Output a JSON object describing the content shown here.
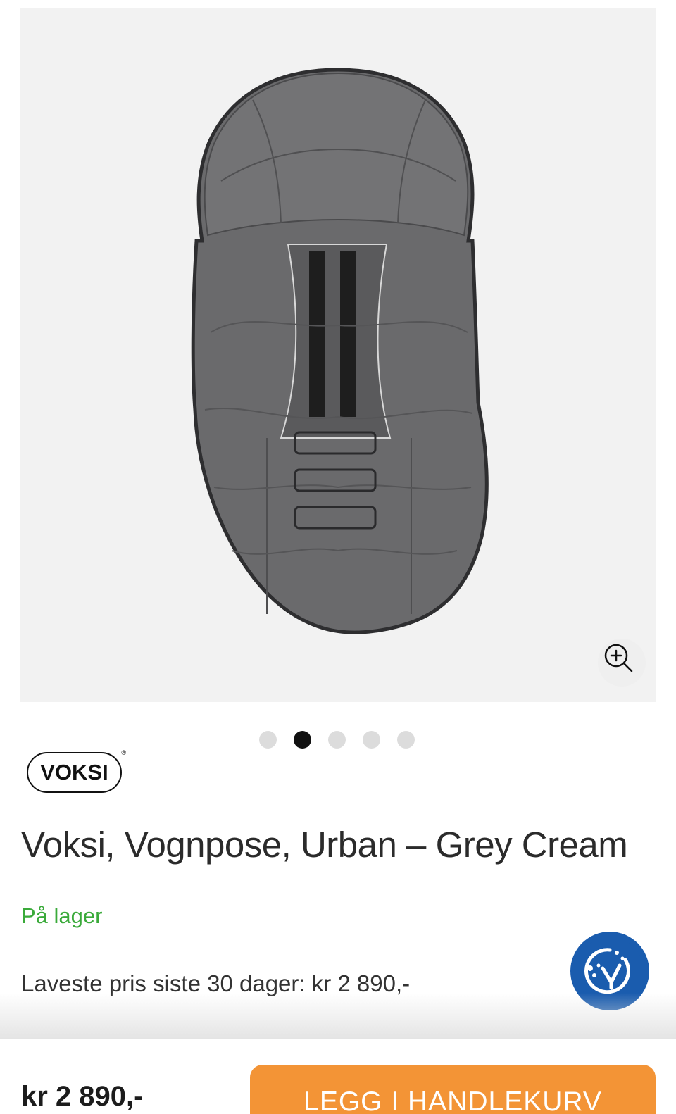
{
  "gallery": {
    "image_alt": "Voksi Vognpose Urban Grey Cream",
    "slide_count": 5,
    "active_slide_index": 1
  },
  "brand": {
    "logo_text": "VOKSI",
    "logo_mark": "®"
  },
  "product": {
    "title": "Voksi, Vognpose, Urban – Grey Cream",
    "stock_status": "På lager",
    "lowest_price_30_days": "Laveste pris siste 30 dager: kr 2 890,-"
  },
  "purchase_bar": {
    "price": "kr 2 890,-",
    "add_to_cart_label": "LEGG I HANDLEKURV"
  },
  "icons": {
    "zoom": "zoom-in-icon",
    "cookie": "cookie-consent-icon"
  },
  "colors": {
    "stock_green": "#3aaa3a",
    "cta_orange": "#f39436",
    "cookie_blue": "#1a5cae",
    "dot_active": "#111111",
    "dot_inactive": "#dcdcdc"
  }
}
